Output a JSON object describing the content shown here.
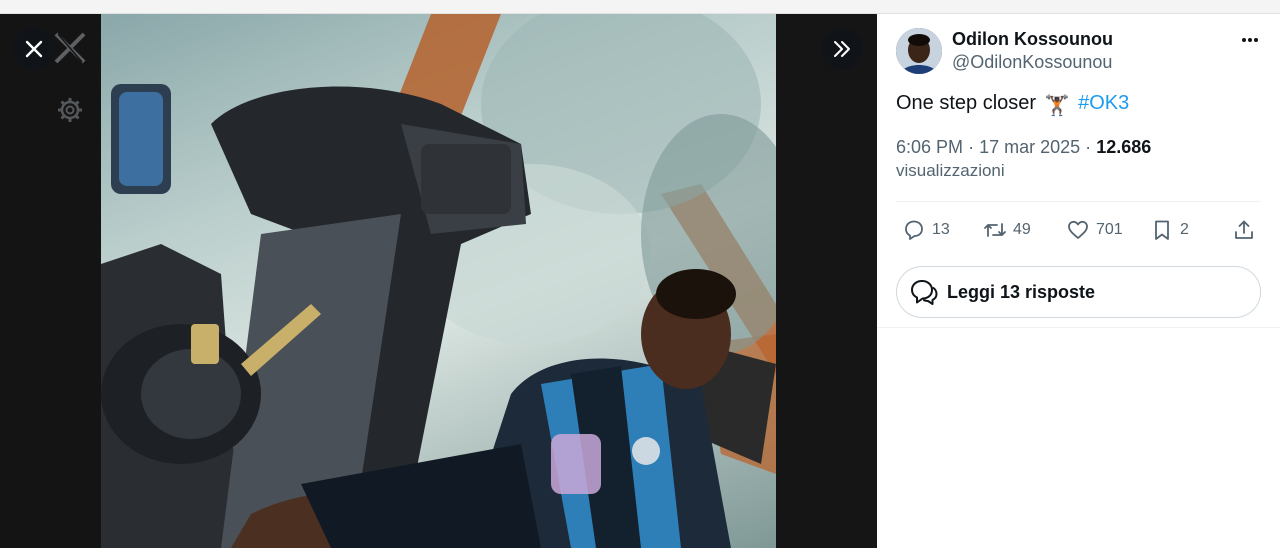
{
  "tweet": {
    "author_name": "Odilon Kossounou",
    "author_handle": "@OdilonKossounou",
    "text": "One step closer",
    "emoji": "🏋🏿",
    "hashtag": "#OK3",
    "time": "6:06 PM",
    "date": "17 mar 2025",
    "views": "12.686",
    "views_label": "visualizzazioni",
    "separator": "·"
  },
  "actions": {
    "replies": "13",
    "retweets": "49",
    "likes": "701",
    "bookmarks": "2"
  },
  "read_replies_label": "Leggi 13 risposte",
  "colors": {
    "accent": "#1d9bf0",
    "text_primary": "#0f1419",
    "text_secondary": "#536471",
    "viewer_bg": "#0c0c0c"
  },
  "icons": {
    "close": "close-icon",
    "expand": "chevrons-right-icon",
    "more": "more-horizontal-icon",
    "reply": "reply-icon",
    "retweet": "retweet-icon",
    "like": "heart-icon",
    "bookmark": "bookmark-icon",
    "share": "share-icon"
  }
}
